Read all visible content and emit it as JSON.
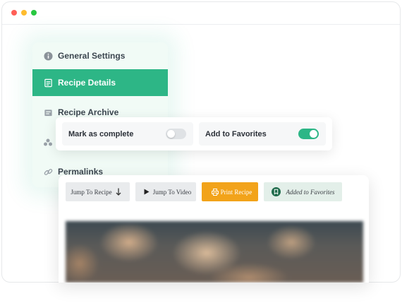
{
  "window": {
    "colors": {
      "red": "#ff5f57",
      "yellow": "#febc2e",
      "green": "#28c840"
    }
  },
  "sidebar": {
    "accent": "#2db686",
    "items": [
      {
        "label": "General Settings",
        "icon": "info-icon",
        "active": false
      },
      {
        "label": "Recipe Details",
        "icon": "document-icon",
        "active": true
      },
      {
        "label": "Recipe Archive",
        "icon": "archive-icon",
        "active": false
      },
      {
        "label": "",
        "icon": "group-icon",
        "active": false
      },
      {
        "label": "Permalinks",
        "icon": "link-icon",
        "active": false
      }
    ]
  },
  "toggles": [
    {
      "label": "Mark as complete",
      "state": "off"
    },
    {
      "label": "Add to Favorites",
      "state": "on"
    }
  ],
  "recipe_card": {
    "buttons": [
      {
        "label": "Jump To Recipe",
        "icon": "arrow-down-icon"
      },
      {
        "label": "Jump To Video",
        "icon": "play-icon"
      },
      {
        "label": "Print Recipe",
        "icon": "printer-icon"
      },
      {
        "label": "Added to Favorites",
        "icon": "bookmark-icon"
      }
    ],
    "print_color": "#f2a31a"
  }
}
